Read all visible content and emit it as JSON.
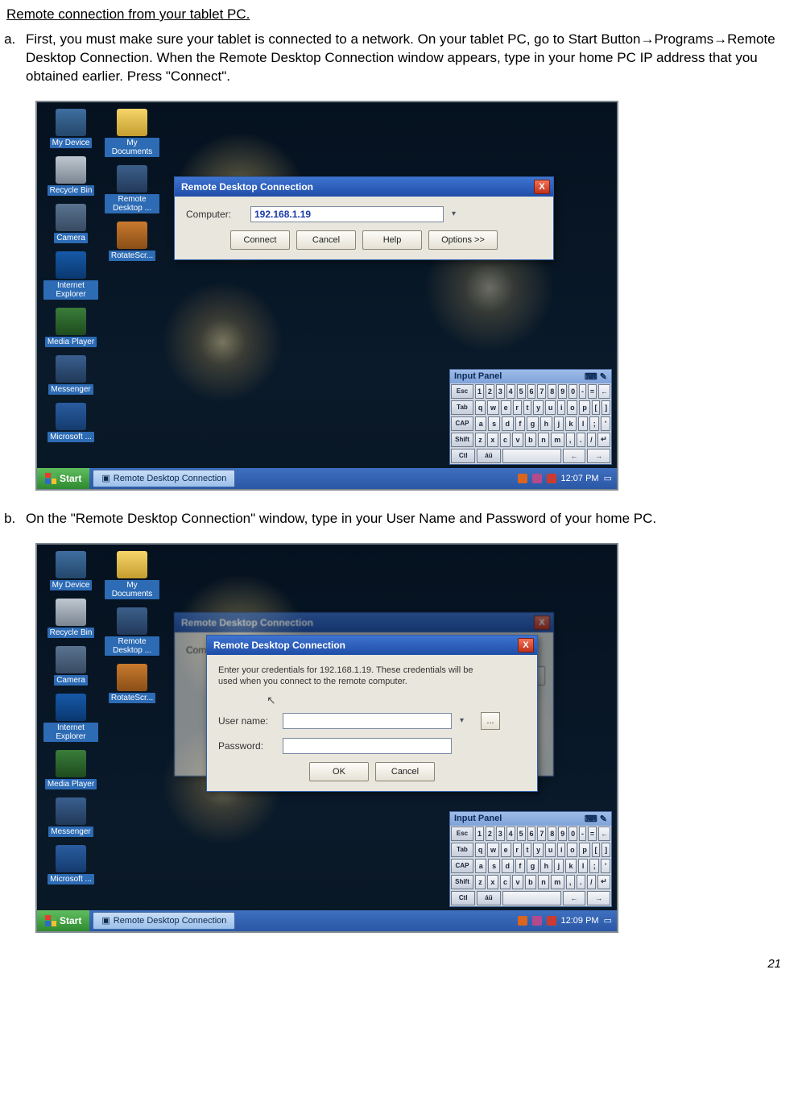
{
  "section_title": "Remote connection from your tablet PC.",
  "steps": {
    "a": "First, you must make sure your tablet is connected to a network. On your tablet PC, go to Start Button→Programs→Remote Desktop Connection.  When the Remote Desktop Connection window appears, type in your home PC IP address that you obtained earlier.  Press \"Connect\".",
    "b": "On the \"Remote Desktop Connection\" window, type in your User Name and Password of your home PC."
  },
  "desktop_icons": [
    {
      "label": "My Device",
      "glyph": "g-device"
    },
    {
      "label": "Recycle Bin",
      "glyph": "g-recycle"
    },
    {
      "label": "Camera",
      "glyph": "g-camera"
    },
    {
      "label": "Internet Explorer",
      "glyph": "g-ie"
    },
    {
      "label": "Media Player",
      "glyph": "g-mp"
    },
    {
      "label": "Messenger",
      "glyph": "g-msn"
    },
    {
      "label": "Microsoft ...",
      "glyph": "g-word"
    },
    {
      "label": "My Documents",
      "glyph": "g-folder"
    },
    {
      "label": "Remote Desktop ...",
      "glyph": "g-rdp"
    },
    {
      "label": "RotateScr...",
      "glyph": "g-rotate"
    }
  ],
  "taskbar": {
    "start": "Start",
    "task_item": "Remote Desktop Connection",
    "clock_a": "12:07 PM",
    "clock_b": "12:09 PM"
  },
  "rdc_dialog": {
    "title": "Remote Desktop Connection",
    "computer_label": "Computer:",
    "computer_value": "192.168.1.19",
    "buttons": {
      "connect": "Connect",
      "cancel": "Cancel",
      "help": "Help",
      "options": "Options >>"
    }
  },
  "cred_dialog": {
    "title": "Remote Desktop Connection",
    "prompt1": "Enter your credentials for 192.168.1.19. These credentials will be",
    "prompt2": "used when you connect to the remote computer.",
    "user_label": "User name:",
    "pass_label": "Password:",
    "ok": "OK",
    "cancel": "Cancel"
  },
  "input_panel": {
    "title": "Input Panel",
    "rows": [
      [
        "Esc",
        "1",
        "2",
        "3",
        "4",
        "5",
        "6",
        "7",
        "8",
        "9",
        "0",
        "-",
        "=",
        "←"
      ],
      [
        "Tab",
        "q",
        "w",
        "e",
        "r",
        "t",
        "y",
        "u",
        "i",
        "o",
        "p",
        "[",
        "]"
      ],
      [
        "CAP",
        "a",
        "s",
        "d",
        "f",
        "g",
        "h",
        "j",
        "k",
        "l",
        ";",
        "'"
      ],
      [
        "Shift",
        "z",
        "x",
        "c",
        "v",
        "b",
        "n",
        "m",
        ",",
        ".",
        "/",
        "↵"
      ],
      [
        "Ctl",
        "áü",
        " ",
        "←",
        "→"
      ]
    ]
  },
  "page_number": "21"
}
